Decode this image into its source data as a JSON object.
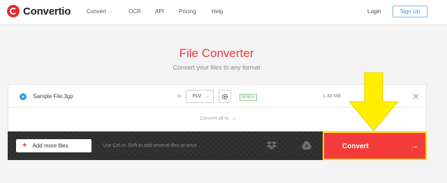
{
  "header": {
    "logo_text": "Convertio",
    "nav": [
      {
        "label": "Convert"
      },
      {
        "label": "OCR"
      },
      {
        "label": "API"
      },
      {
        "label": "Pricing"
      },
      {
        "label": "Help"
      }
    ],
    "login_label": "Login",
    "signup_label": "Sign Up"
  },
  "main": {
    "title": "File Converter",
    "subtitle": "Convert your files to any format"
  },
  "file_row": {
    "filename": "Sample File.3gp",
    "to_label": "to",
    "format": "FLV",
    "status": "READY",
    "size": "1.40 MB"
  },
  "convert_all_label": "Convert all to",
  "bottom_bar": {
    "add_files_label": "Add more files",
    "hint": "Use Ctrl or Shift to add several files at once",
    "convert_label": "Convert"
  },
  "colors": {
    "brand_red": "#f33b3b",
    "highlight_yellow": "#ffde00",
    "accent_blue": "#3d8fd6",
    "ready_green": "#4caf50"
  },
  "icons": [
    "logo-icon",
    "chevron-down-icon",
    "play-icon",
    "gear-icon",
    "close-icon",
    "plus-icon",
    "dropbox-icon",
    "google-drive-icon",
    "arrow-right-icon",
    "annotation-arrow-icon"
  ]
}
